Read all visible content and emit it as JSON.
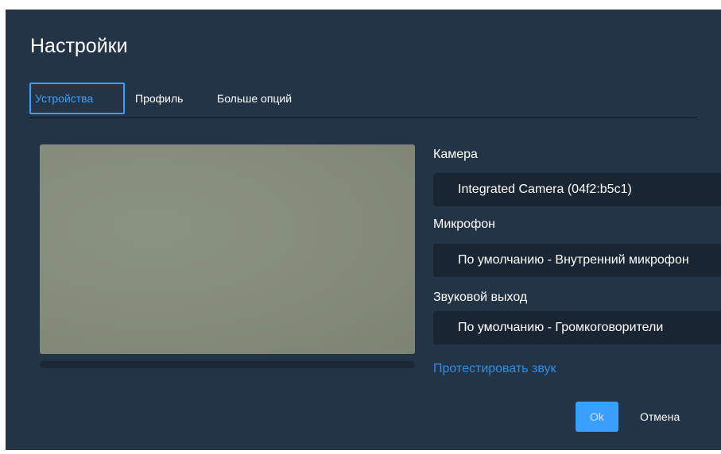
{
  "dialog": {
    "title": "Настройки",
    "tabs": [
      {
        "label": "Устройства",
        "active": true
      },
      {
        "label": "Профиль",
        "active": false
      },
      {
        "label": "Больше опций",
        "active": false
      }
    ]
  },
  "devices": {
    "camera": {
      "label": "Камера",
      "value": "Integrated Camera (04f2:b5c1)"
    },
    "microphone": {
      "label": "Микрофон",
      "value": "По умолчанию - Внутренний микрофон"
    },
    "audio_output": {
      "label": "Звуковой выход",
      "value": "По умолчанию - Громкоговорители"
    },
    "test_audio_label": "Протестировать звук",
    "mic_level": 0
  },
  "footer": {
    "ok_label": "Ok",
    "cancel_label": "Отмена"
  },
  "colors": {
    "background": "#243447",
    "accent": "#3aa0ff",
    "select_bg": "#1a2533",
    "link": "#2d8fe6"
  }
}
